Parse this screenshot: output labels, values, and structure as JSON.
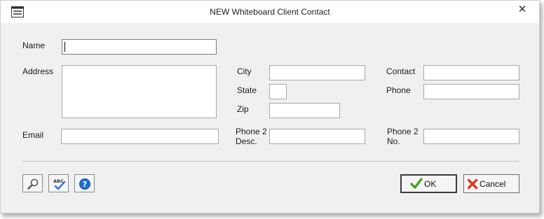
{
  "window": {
    "title": "NEW Whiteboard Client Contact",
    "close_glyph": "✕",
    "icon": "form-window-icon"
  },
  "form": {
    "name_label": "Name",
    "name_value": "",
    "address_label": "Address",
    "address_value": "",
    "email_label": "Email",
    "email_value": "",
    "city_label": "City",
    "city_value": "",
    "state_label": "State",
    "state_value": "",
    "zip_label": "Zip",
    "zip_value": "",
    "phone2desc_label_line1": "Phone 2",
    "phone2desc_label_line2": "Desc.",
    "phone2desc_value": "",
    "contact_label": "Contact",
    "contact_value": "",
    "phone_label": "Phone",
    "phone_value": "",
    "phone2no_label_line1": "Phone 2",
    "phone2no_label_line2": "No.",
    "phone2no_value": ""
  },
  "toolbar": {
    "search_icon": "magnifier-icon",
    "spellcheck_icon": "spellcheck-icon",
    "spellcheck_text": "ABC",
    "help_icon": "help-icon",
    "help_glyph": "?"
  },
  "buttons": {
    "ok_label": "OK",
    "cancel_label": "Cancel"
  },
  "colors": {
    "ok_check": "#3aa317",
    "cancel_x": "#e0391f",
    "help_blue": "#1e6fd1",
    "spell_check": "#2b6fd6"
  }
}
